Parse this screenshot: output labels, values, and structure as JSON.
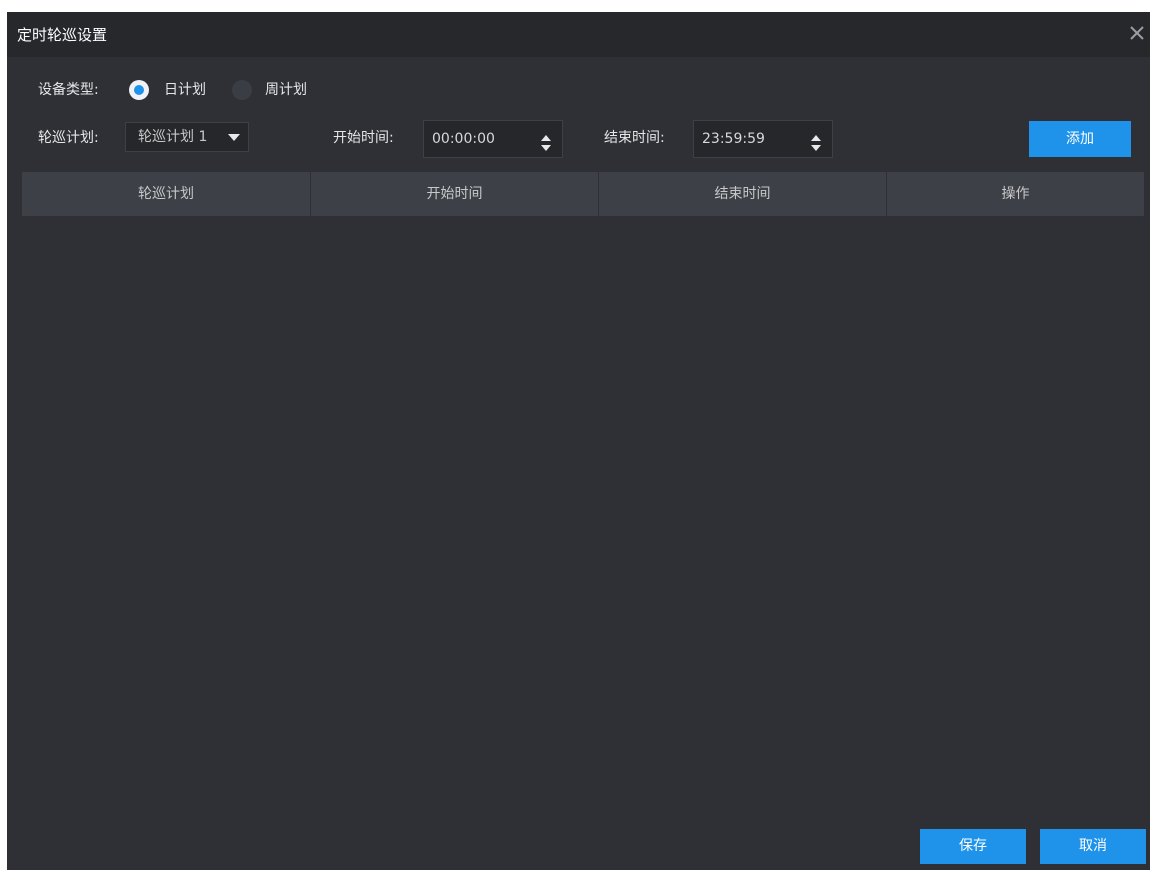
{
  "dialog": {
    "title": "定时轮巡设置"
  },
  "device_type": {
    "label": "设备类型:",
    "options": [
      {
        "label": "日计划",
        "checked": true
      },
      {
        "label": "周计划",
        "checked": false
      }
    ]
  },
  "plan": {
    "label": "轮巡计划:",
    "selected": "轮巡计划 1"
  },
  "start_time": {
    "label": "开始时间:",
    "value": "00:00:00"
  },
  "end_time": {
    "label": "结束时间:",
    "value": "23:59:59"
  },
  "add_button": "添加",
  "table": {
    "columns": [
      "轮巡计划",
      "开始时间",
      "结束时间",
      "操作"
    ],
    "rows": []
  },
  "footer": {
    "save": "保存",
    "cancel": "取消"
  },
  "colors": {
    "accent": "#1f93ea",
    "background": "#2e3035",
    "titlebar": "#26282c",
    "header": "#3d4046"
  }
}
